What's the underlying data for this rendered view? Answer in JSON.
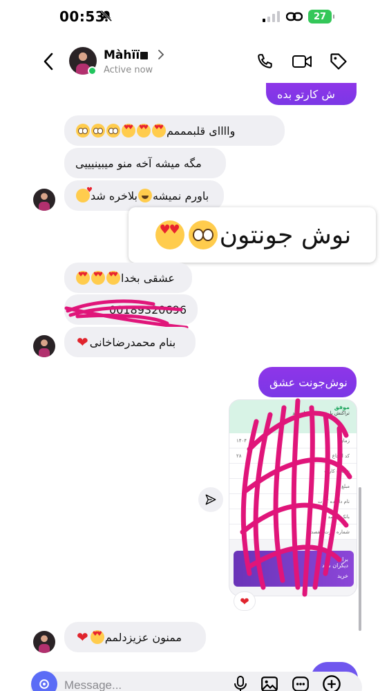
{
  "status_bar": {
    "time": "00:53",
    "battery": "27"
  },
  "header": {
    "name": "Màhïï",
    "status": "Active now"
  },
  "messages": {
    "out1": "ش کارتو بده",
    "in1": "واااای قلبمممم",
    "in2": "مگه میشه آخه منو میبینیییی",
    "in3": "باورم نمیشه",
    "in3b": "بلاخره شد",
    "sticker": "نوش جونتون",
    "in4": "عشقی بخدا",
    "in5": "00189320696",
    "in6": "بنام محمدرضاخانی",
    "out2": "نوش‌جونت عشق",
    "in7": "ممنون عزیزدلمم"
  },
  "receipt": {
    "status": "موفق",
    "subtitle": "تراکنش با موفقیت انجام شد",
    "rows": [
      {
        "label": "زمان",
        "value": "۱۴۰۴"
      },
      {
        "label": "کد ارجاع",
        "value": "۲۸"
      },
      {
        "label": "شماره کارت",
        "value": ""
      },
      {
        "label": "مبلغ",
        "value": ""
      },
      {
        "label": "نام دارنده کارت",
        "value": ""
      },
      {
        "label": "بانک مقصد",
        "value": ""
      },
      {
        "label": "شماره کارت مقصد",
        "value": ""
      }
    ],
    "banner_line1": "برای",
    "banner_line2": "دیگران شاد",
    "banner_btn": "خرید"
  },
  "reaction": "❤",
  "composer": {
    "placeholder": "Message..."
  },
  "icons": {
    "back": "chevron-left-icon",
    "call": "phone-icon",
    "video": "video-camera-icon",
    "tag": "tag-icon",
    "share": "paper-plane-icon",
    "mic": "microphone-icon",
    "gallery": "image-icon",
    "sticker": "sticker-icon",
    "add": "plus-circle-icon",
    "camera": "camera-icon"
  },
  "colors": {
    "outgoing_bubble": "#8e36e8",
    "incoming_bubble": "#efeff3",
    "scribble": "#e0157a",
    "online": "#22c55e",
    "camera_button": "#5b6cf6"
  }
}
